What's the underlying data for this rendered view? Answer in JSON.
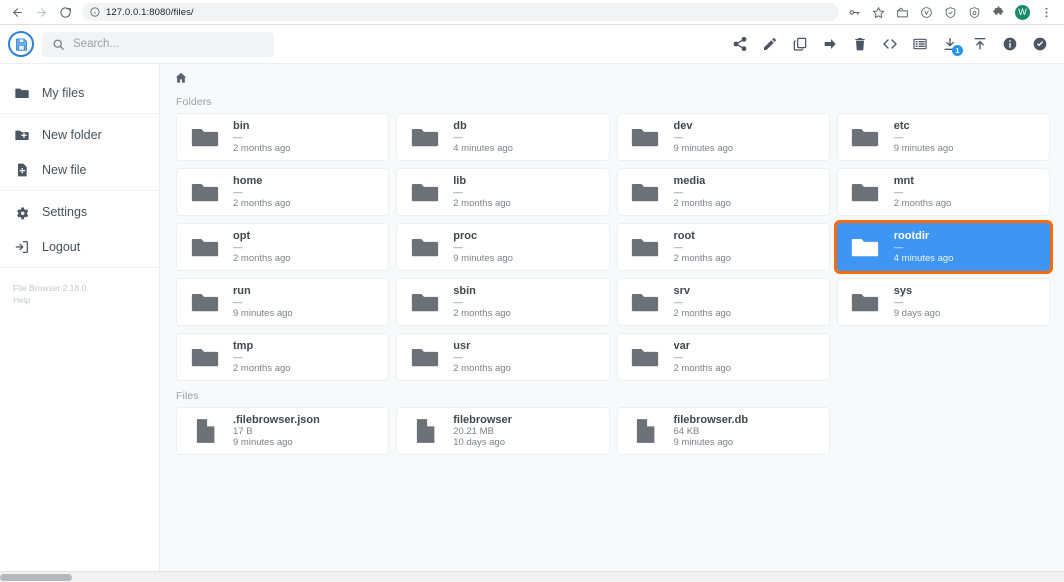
{
  "browser": {
    "url": "127.0.0.1:8080/files/",
    "nav": {
      "back": "back-arrow",
      "forward": "forward-arrow",
      "reload": "reload"
    },
    "profile_initial": "W",
    "icons": [
      "key-icon",
      "star-icon",
      "extension-box-icon",
      "shield-v-icon",
      "shield-check-icon",
      "shield-lock-icon",
      "puzzle-icon",
      "profile-avatar",
      "kebab-menu-icon"
    ]
  },
  "app": {
    "logo": "floppy-disk-save-icon",
    "search": {
      "placeholder": "Search...",
      "value": ""
    },
    "actions": [
      {
        "name": "share-button",
        "label": "Share"
      },
      {
        "name": "rename-button",
        "label": "Rename"
      },
      {
        "name": "copy-button",
        "label": "Copy"
      },
      {
        "name": "move-button",
        "label": "Move"
      },
      {
        "name": "delete-button",
        "label": "Delete"
      },
      {
        "name": "shell-button",
        "label": "Shell"
      },
      {
        "name": "switch-view-button",
        "label": "Switch view"
      },
      {
        "name": "download-button",
        "label": "Download",
        "badge": "1"
      },
      {
        "name": "upload-button",
        "label": "Upload"
      },
      {
        "name": "info-button",
        "label": "Info"
      },
      {
        "name": "select-multiple-button",
        "label": "Select multiple"
      }
    ]
  },
  "sidebar": {
    "groups": [
      {
        "items": [
          {
            "label": "My files",
            "icon": "folder-icon",
            "name": "sidebar-item-my-files"
          }
        ]
      },
      {
        "items": [
          {
            "label": "New folder",
            "icon": "new-folder-icon",
            "name": "sidebar-item-new-folder"
          },
          {
            "label": "New file",
            "icon": "new-file-icon",
            "name": "sidebar-item-new-file"
          }
        ]
      },
      {
        "items": [
          {
            "label": "Settings",
            "icon": "gear-icon",
            "name": "sidebar-item-settings"
          },
          {
            "label": "Logout",
            "icon": "logout-icon",
            "name": "sidebar-item-logout"
          }
        ]
      }
    ],
    "footer": {
      "version": "File Browser 2.18.0",
      "help": "Help"
    }
  },
  "main": {
    "breadcrumb": {
      "home": "home-icon"
    },
    "sections": {
      "folders_label": "Folders",
      "files_label": "Files"
    },
    "folders": [
      {
        "name": "bin",
        "size": "—",
        "modified": "2 months ago",
        "selected": false
      },
      {
        "name": "db",
        "size": "—",
        "modified": "4 minutes ago",
        "selected": false
      },
      {
        "name": "dev",
        "size": "—",
        "modified": "9 minutes ago",
        "selected": false
      },
      {
        "name": "etc",
        "size": "—",
        "modified": "9 minutes ago",
        "selected": false
      },
      {
        "name": "home",
        "size": "—",
        "modified": "2 months ago",
        "selected": false
      },
      {
        "name": "lib",
        "size": "—",
        "modified": "2 months ago",
        "selected": false
      },
      {
        "name": "media",
        "size": "—",
        "modified": "2 months ago",
        "selected": false
      },
      {
        "name": "mnt",
        "size": "—",
        "modified": "2 months ago",
        "selected": false
      },
      {
        "name": "opt",
        "size": "—",
        "modified": "2 months ago",
        "selected": false
      },
      {
        "name": "proc",
        "size": "—",
        "modified": "9 minutes ago",
        "selected": false
      },
      {
        "name": "root",
        "size": "—",
        "modified": "2 months ago",
        "selected": false
      },
      {
        "name": "rootdir",
        "size": "—",
        "modified": "4 minutes ago",
        "selected": true
      },
      {
        "name": "run",
        "size": "—",
        "modified": "9 minutes ago",
        "selected": false
      },
      {
        "name": "sbin",
        "size": "—",
        "modified": "2 months ago",
        "selected": false
      },
      {
        "name": "srv",
        "size": "—",
        "modified": "2 months ago",
        "selected": false
      },
      {
        "name": "sys",
        "size": "—",
        "modified": "9 days ago",
        "selected": false
      },
      {
        "name": "tmp",
        "size": "—",
        "modified": "2 months ago",
        "selected": false
      },
      {
        "name": "usr",
        "size": "—",
        "modified": "2 months ago",
        "selected": false
      },
      {
        "name": "var",
        "size": "—",
        "modified": "2 months ago",
        "selected": false
      }
    ],
    "files": [
      {
        "name": ".filebrowser.json",
        "size": "17 B",
        "modified": "9 minutes ago"
      },
      {
        "name": "filebrowser",
        "size": "20.21 MB",
        "modified": "10 days ago"
      },
      {
        "name": "filebrowser.db",
        "size": "64 KB",
        "modified": "9 minutes ago"
      }
    ]
  },
  "colors": {
    "selection_blue": "#3f95f3",
    "highlight_orange": "#f96a08",
    "badge_blue": "#2196f3",
    "logo_blue": "#2f81d6",
    "main_bg": "#f8f9fa"
  }
}
